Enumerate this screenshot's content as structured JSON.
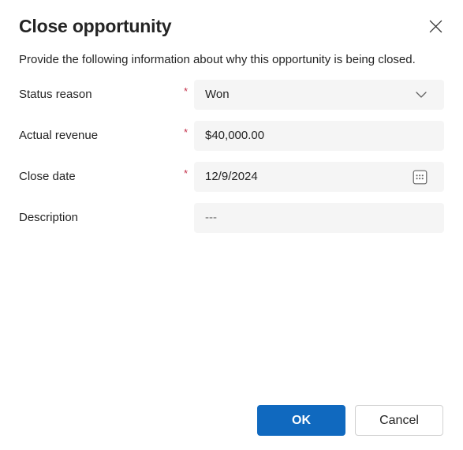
{
  "dialog": {
    "title": "Close opportunity",
    "description": "Provide the following information about why this opportunity is being closed.",
    "close_icon": "close-icon"
  },
  "form": {
    "fields": [
      {
        "label": "Status reason",
        "required_mark": "*",
        "value": "Won",
        "type": "select",
        "trailing_icon": "chevron-down-icon"
      },
      {
        "label": "Actual revenue",
        "required_mark": "*",
        "value": "$40,000.00",
        "type": "text",
        "trailing_icon": ""
      },
      {
        "label": "Close date",
        "required_mark": "*",
        "value": "12/9/2024",
        "type": "date",
        "trailing_icon": "calendar-icon"
      },
      {
        "label": "Description",
        "required_mark": "",
        "value": "---",
        "type": "text",
        "trailing_icon": "",
        "is_placeholder": true
      }
    ]
  },
  "footer": {
    "ok_label": "OK",
    "cancel_label": "Cancel"
  },
  "colors": {
    "accent": "#1069bf",
    "required": "#c4314b",
    "field_background": "#f5f5f5",
    "text": "#242424",
    "placeholder_text": "#707070",
    "border": "#d1d1d1"
  }
}
